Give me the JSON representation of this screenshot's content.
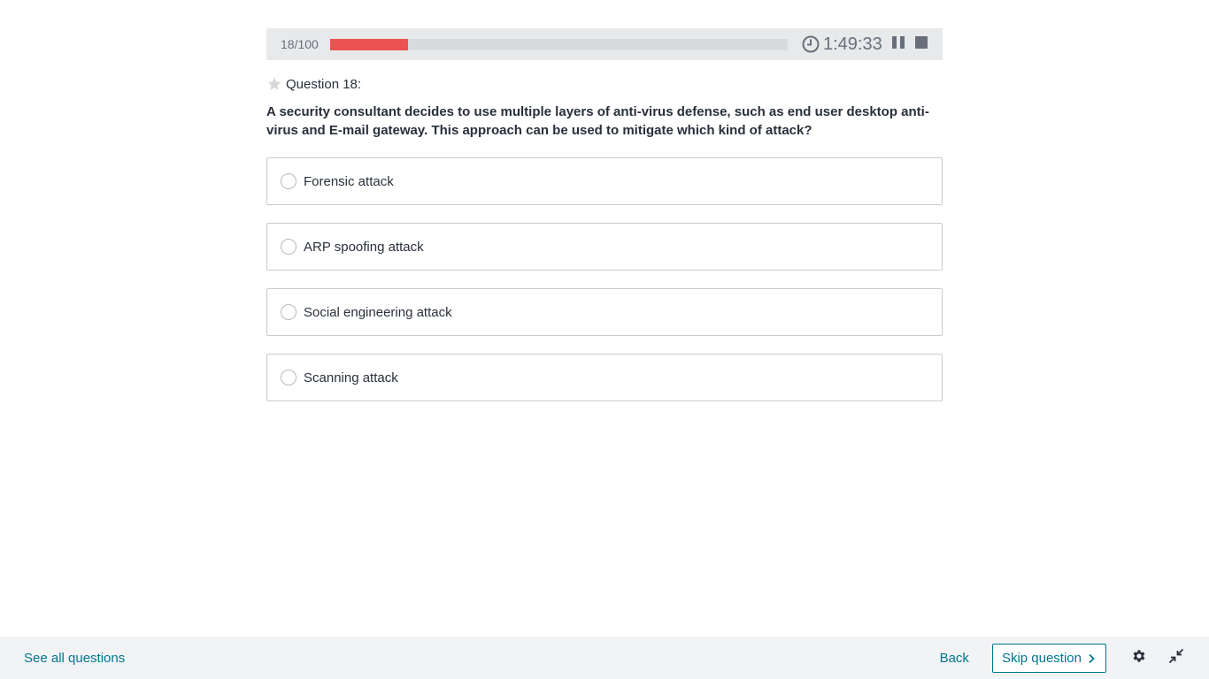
{
  "progress": {
    "count_text": "18/100",
    "fraction": 0.17,
    "fill_color": "#ec5252"
  },
  "timer": {
    "time": "1:49:33",
    "clock_icon": "clock-icon",
    "pause_icon": "pause-icon",
    "stop_icon": "stop-icon"
  },
  "question": {
    "label": "Question 18:",
    "star_icon": "star-icon",
    "text": "A security consultant decides to use multiple layers of anti-virus defense, such as end user desktop anti-virus and E-mail gateway. This approach can be used to mitigate which kind of attack?"
  },
  "answers": [
    {
      "label": "Forensic attack"
    },
    {
      "label": "ARP spoofing attack"
    },
    {
      "label": "Social engineering attack"
    },
    {
      "label": "Scanning attack"
    }
  ],
  "footer": {
    "see_all": "See all questions",
    "back": "Back",
    "skip": "Skip question",
    "settings_icon": "gear-icon",
    "collapse_icon": "collapse-icon",
    "link_color": "#007791"
  }
}
